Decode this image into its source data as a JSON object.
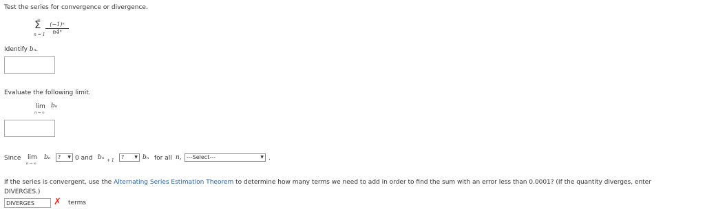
{
  "question": {
    "intro": "Test the series for convergence or divergence.",
    "series": {
      "sigma": "Σ",
      "upper": "∞",
      "lower": "n = 1",
      "numerator": "(−1)ⁿ",
      "denominator": "n4ⁿ"
    },
    "identify_label": "Identify",
    "identify_var": "bₙ.",
    "evaluate_label": "Evaluate the following limit.",
    "limit": {
      "lim": "lim",
      "sub": "n → ∞",
      "var": "bₙ"
    },
    "since": {
      "since_text": "Since",
      "lim": "lim",
      "sub": "n → ∞",
      "var": "bₙ",
      "select1": "?",
      "zero_and": "0 and",
      "bn1": "bₙ",
      "plus1": "+ 1",
      "select2": "?",
      "bn": "bₙ",
      "for_all": "for all",
      "n": "n,",
      "select3": "---Select---",
      "period": "."
    },
    "estimation": {
      "prefix": "If the series is convergent, use the",
      "link_text": "Alternating Series Estimation Theorem",
      "suffix": "to determine how many terms we need to add in order to find the sum with an error less than 0.0001? (If the quantity diverges, enter",
      "line2": "DIVERGES.)",
      "answer_value": "DIVERGES",
      "terms_label": "terms",
      "incorrect_mark": "✗",
      "incorrect_color": "#e0281e"
    }
  }
}
